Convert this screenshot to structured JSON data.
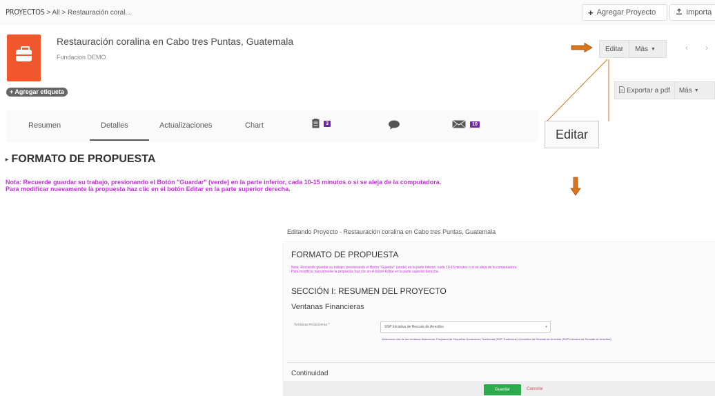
{
  "breadcrumb": {
    "root": "PROYECTOS",
    "separator1": ">",
    "all": "All",
    "separator2": ">",
    "current": "Restauración coral..."
  },
  "toolbar": {
    "add_project": "Agregar Proyecto",
    "import": "Importa"
  },
  "project": {
    "title": "Restauración coralina en Cabo tres Puntas, Guatemala",
    "organization": "Fundacion DEMO",
    "add_tag": "+ Agregar etiqueta",
    "logo_icon": "briefcase-icon",
    "logo_color": "#f0572c"
  },
  "actions": {
    "edit": "Editar",
    "more": "Más",
    "export_pdf": "Exportar a pdf",
    "more2": "Más"
  },
  "callout": {
    "label": "Editar",
    "arrow_color": "#d9751a"
  },
  "tabs": [
    {
      "label": "Resumen"
    },
    {
      "label": "Detalles",
      "active": true
    },
    {
      "label": "Actualizaciones"
    },
    {
      "label": "Chart"
    },
    {
      "icon": "document-icon",
      "badge": "3"
    },
    {
      "icon": "chat-bubble-icon"
    },
    {
      "icon": "envelope-icon",
      "badge": "10"
    }
  ],
  "section": {
    "title": "FORMATO DE PROPUESTA",
    "note_line1": "Nota: Recuerde guardar su trabajo, presionando el Botón \"Guardar\" (verde) en la parte inferior, cada 10-15 minutos o si se aleja de la computadora.",
    "note_line2": "Para modificar nuevamente la propuesta haz clic en el botón Editar en la parte superior derecha.",
    "note_color": "#c433d8"
  },
  "editing": {
    "header": "Editando Proyecto - Restauración coralina en Cabo tres Puntas, Guatemala",
    "form_title": "FORMATO DE PROPUESTA",
    "note_line1": "Nota: Recuerde guardar su trabajo, presionando el Botón \"Guardar\" (verde) en la parte inferior, cada 10-15 minutos o si se aleja de la computadora.",
    "note_line2": "Para modificar nuevamente la propuesta haz clic en el botón Editar en la parte superior derecha.",
    "section_title": "SECCIÓN I: RESUMEN DEL PROYECTO",
    "subsection": "Ventanas Financieras",
    "field_label": "Ventanas Financieras *",
    "field_value": "SGP Iniciativa de Rescate de Arrecifes",
    "field_help": "Seleccione una de las ventanas financieras: Programa de Pequeñas Donaciones Tradicional (SGP Tradicional) o Iniciativa de Rescate de Arrecifes (SGP Iniciativa de Rescate de Arrecifes)",
    "continuity": "Continuidad",
    "save": "Guardar",
    "cancel": "Cancelar",
    "save_color": "#2eaa4d"
  }
}
